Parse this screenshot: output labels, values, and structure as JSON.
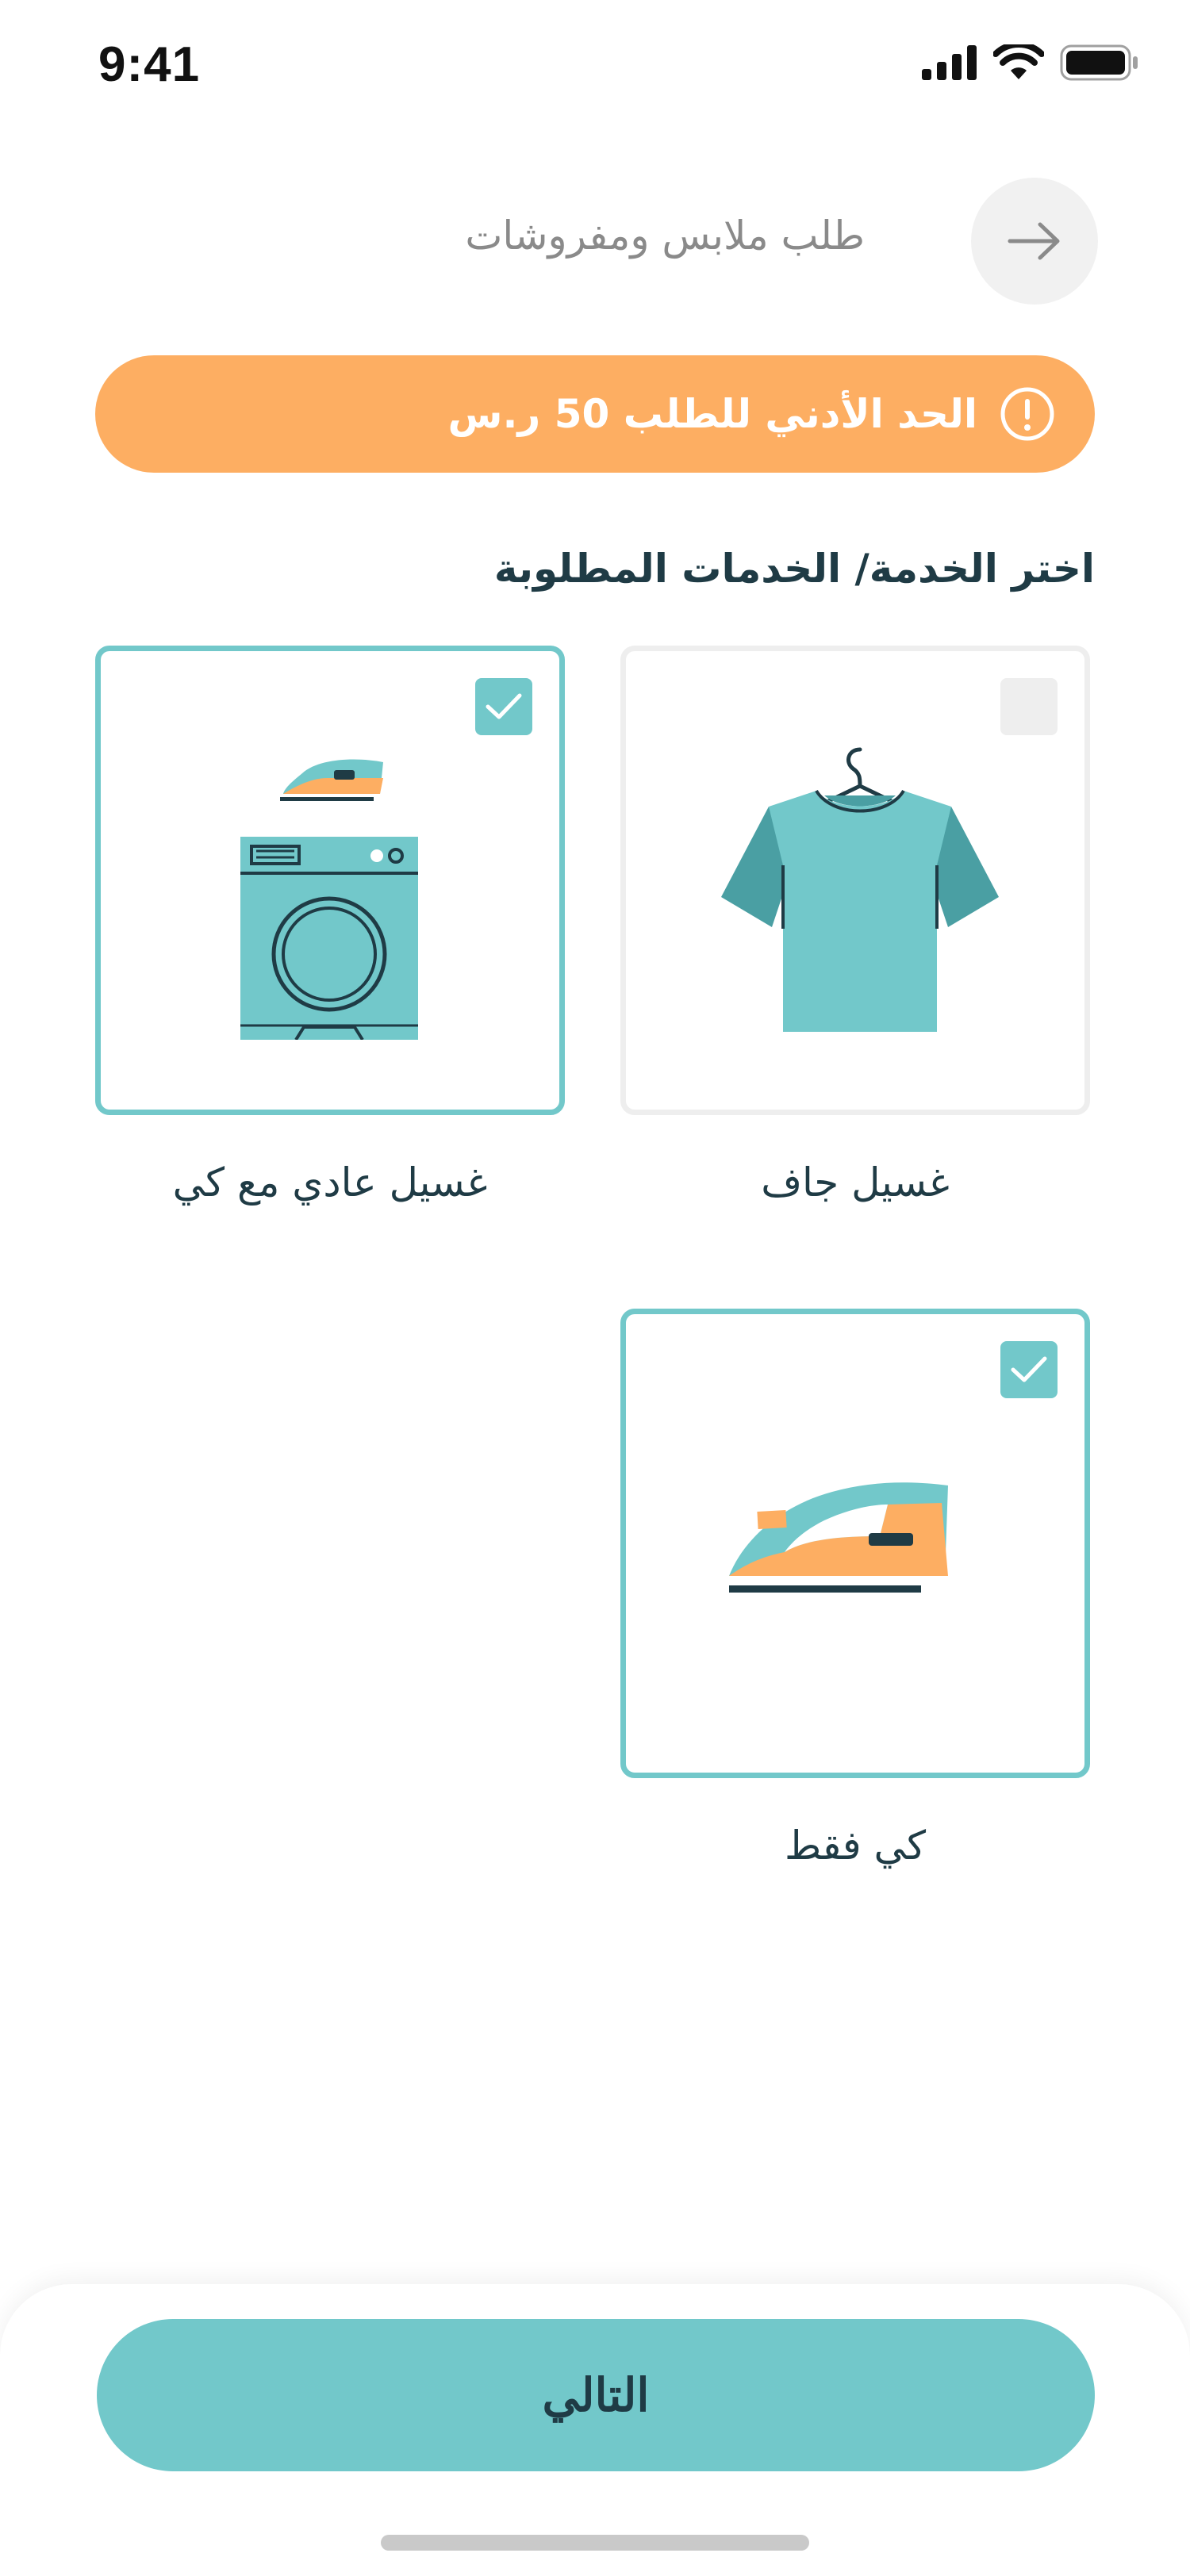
{
  "status_bar": {
    "time": "9:41"
  },
  "header": {
    "title": "طلب ملابس ومفروشات",
    "back_icon": "arrow-right-icon"
  },
  "banner": {
    "text": "الحد الأدني للطلب 50 ر.س",
    "icon": "exclamation-circle-icon",
    "color": "#fdae62"
  },
  "section_title": "اختر الخدمة/ الخدمات المطلوبة",
  "services": [
    {
      "label": "غسيل جاف",
      "selected": false,
      "icon": "tshirt-hanger-icon"
    },
    {
      "label": "غسيل عادي مع كي",
      "selected": true,
      "icon": "washing-machine-iron-icon"
    },
    {
      "label": "كي فقط",
      "selected": true,
      "icon": "iron-icon"
    }
  ],
  "next_button": {
    "label": "التالي"
  },
  "colors": {
    "accent": "#72c8ca",
    "orange": "#fdae62",
    "text": "#1f3b45"
  }
}
